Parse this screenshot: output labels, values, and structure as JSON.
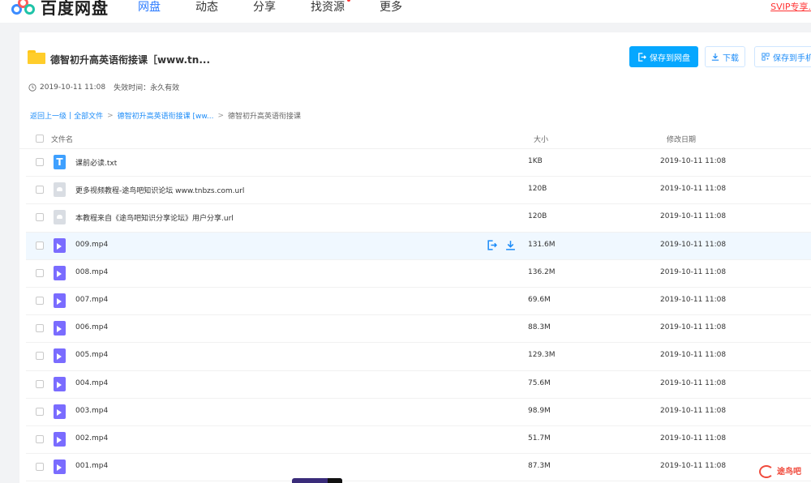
{
  "app": {
    "logo_text": "百度网盘"
  },
  "nav": {
    "items": [
      "网盘",
      "动态",
      "分享",
      "找资源",
      "更多"
    ],
    "vip_link": "SVIP专享."
  },
  "share": {
    "title": "德智初升高英语衔接课［www.tn...",
    "created": "2019-10-11 11:08",
    "expire_label": "失效时间：",
    "expire_value": "永久有效",
    "save_button": "保存到网盘",
    "download_button": "下载",
    "phone_button": "保存到手机"
  },
  "breadcrumb": {
    "back": "返回上一级",
    "all_files": "全部文件",
    "parent": "德智初升高英语衔接课 [ww...",
    "current": "德智初升高英语衔接课"
  },
  "table": {
    "columns": {
      "name": "文件名",
      "size": "大小",
      "date": "修改日期"
    },
    "rows": [
      {
        "name": "课前必读.txt",
        "size": "1KB",
        "date": "2019-10-11 11:08",
        "type": "txt"
      },
      {
        "name": "更多视频教程-途鸟吧知识论坛 www.tnbzs.com.url",
        "size": "120B",
        "date": "2019-10-11 11:08",
        "type": "url"
      },
      {
        "name": "本教程来自《途鸟吧知识分享论坛》用户分享.url",
        "size": "120B",
        "date": "2019-10-11 11:08",
        "type": "url"
      },
      {
        "name": "009.mp4",
        "size": "131.6M",
        "date": "2019-10-11 11:08",
        "type": "video"
      },
      {
        "name": "008.mp4",
        "size": "136.2M",
        "date": "2019-10-11 11:08",
        "type": "video"
      },
      {
        "name": "007.mp4",
        "size": "69.6M",
        "date": "2019-10-11 11:08",
        "type": "video"
      },
      {
        "name": "006.mp4",
        "size": "88.3M",
        "date": "2019-10-11 11:08",
        "type": "video"
      },
      {
        "name": "005.mp4",
        "size": "129.3M",
        "date": "2019-10-11 11:08",
        "type": "video"
      },
      {
        "name": "004.mp4",
        "size": "75.6M",
        "date": "2019-10-11 11:08",
        "type": "video"
      },
      {
        "name": "003.mp4",
        "size": "98.9M",
        "date": "2019-10-11 11:08",
        "type": "video"
      },
      {
        "name": "002.mp4",
        "size": "51.7M",
        "date": "2019-10-11 11:08",
        "type": "video"
      },
      {
        "name": "001.mp4",
        "size": "87.3M",
        "date": "2019-10-11 11:08",
        "type": "video"
      }
    ]
  },
  "watermark": {
    "text": "途鸟吧"
  },
  "colors": {
    "accent": "#06a7ff",
    "nav_active": "#2e7cff",
    "link": "#1d8cf8",
    "video_icon": "#7a6cff",
    "folder": "#ffcd2b"
  }
}
